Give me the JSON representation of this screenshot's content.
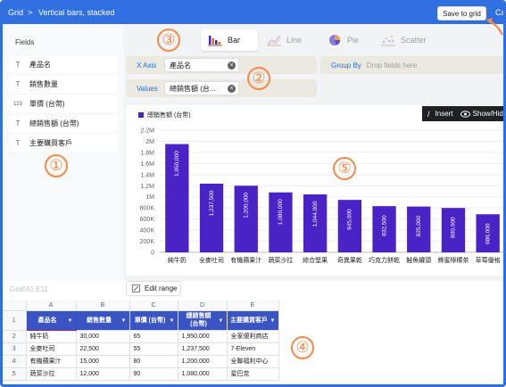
{
  "breadcrumb": {
    "root": "Grid",
    "separator": ">",
    "current": "Vertical bars, stacked"
  },
  "toolbar": {
    "save_label": "Save to grid",
    "cancel_fragment": "Ca"
  },
  "fields": {
    "title": "Fields",
    "items": [
      {
        "type_icon": "T",
        "label": "產品名"
      },
      {
        "type_icon": "T",
        "label": "銷售數量"
      },
      {
        "type_icon": "123",
        "label": "單價 (台幣)"
      },
      {
        "type_icon": "T",
        "label": "總銷售額 (台幣)"
      },
      {
        "type_icon": "T",
        "label": "主要購買客戶"
      }
    ]
  },
  "chart_types": [
    {
      "label": "Bar",
      "active": true
    },
    {
      "label": "Line",
      "active": false
    },
    {
      "label": "Pie",
      "active": false
    },
    {
      "label": "Scatter",
      "active": false
    }
  ],
  "config": {
    "x_axis_label": "X Axis",
    "x_axis_value": "產品名",
    "group_by_label": "Group By",
    "group_by_placeholder": "Drop fields here",
    "values_label": "Values",
    "values_value": "總銷售額 (台..."
  },
  "chart_toolbar": {
    "insert_label": "Insert",
    "show_hide_label": "Show/Hide"
  },
  "chart_data": {
    "type": "bar",
    "legend": "總銷售額 (台幣)",
    "categories": [
      "純牛奶",
      "全麥吐司",
      "有機蘋果汁",
      "蔬菜沙拉",
      "綜合堅果",
      "奇異果乾",
      "巧克力餅乾",
      "鮭魚罐頭",
      "蜂蜜檸檬茶",
      "草莓優格"
    ],
    "values": [
      1950000,
      1237500,
      1200000,
      1080000,
      1044000,
      945000,
      832500,
      825000,
      800000,
      686000
    ],
    "value_labels": [
      "1,950,000",
      "1,237,500",
      "1,200,000",
      "1,080,000",
      "1,044,000",
      "945,000",
      "832,500",
      "825,000",
      "800,000",
      "686,000"
    ],
    "ytick_labels": [
      "0",
      "200K",
      "400K",
      "600K",
      "800K",
      "1M",
      "1.2M",
      "1.4M",
      "1.6M",
      "1.8M",
      "2M",
      "2.2M"
    ],
    "ylim": [
      0,
      2200000
    ],
    "grid": true,
    "color": "#4a23c7"
  },
  "grid": {
    "range": "Grid!A1:E11",
    "edit_range_label": "Edit range",
    "column_letters": [
      "A",
      "B",
      "C",
      "D",
      "E"
    ],
    "headers": [
      "產品名",
      "銷售數量",
      "單價 (台幣)",
      "總銷售額\n(台幣)",
      "主要購買客戶"
    ],
    "rows": [
      {
        "num": "2",
        "cells": [
          "純牛奶",
          "30,000",
          "65",
          "1,950,000",
          "全家便利商店"
        ]
      },
      {
        "num": "3",
        "cells": [
          "全麥吐司",
          "22,500",
          "55",
          "1,237,500",
          "7-Eleven"
        ]
      },
      {
        "num": "4",
        "cells": [
          "有機蘋果汁",
          "15,000",
          "80",
          "1,200,000",
          "全聯福利中心"
        ]
      },
      {
        "num": "5",
        "cells": [
          "蔬菜沙拉",
          "12,000",
          "90",
          "1,080,000",
          "星巴克"
        ]
      }
    ],
    "header_row_num": "1"
  },
  "annotations": [
    "①",
    "②",
    "③",
    "④",
    "⑤"
  ],
  "colors": {
    "accent": "#2f6fe0",
    "bar": "#4a23c7",
    "header": "#3b54c4",
    "annotation": "#f58a4b"
  }
}
